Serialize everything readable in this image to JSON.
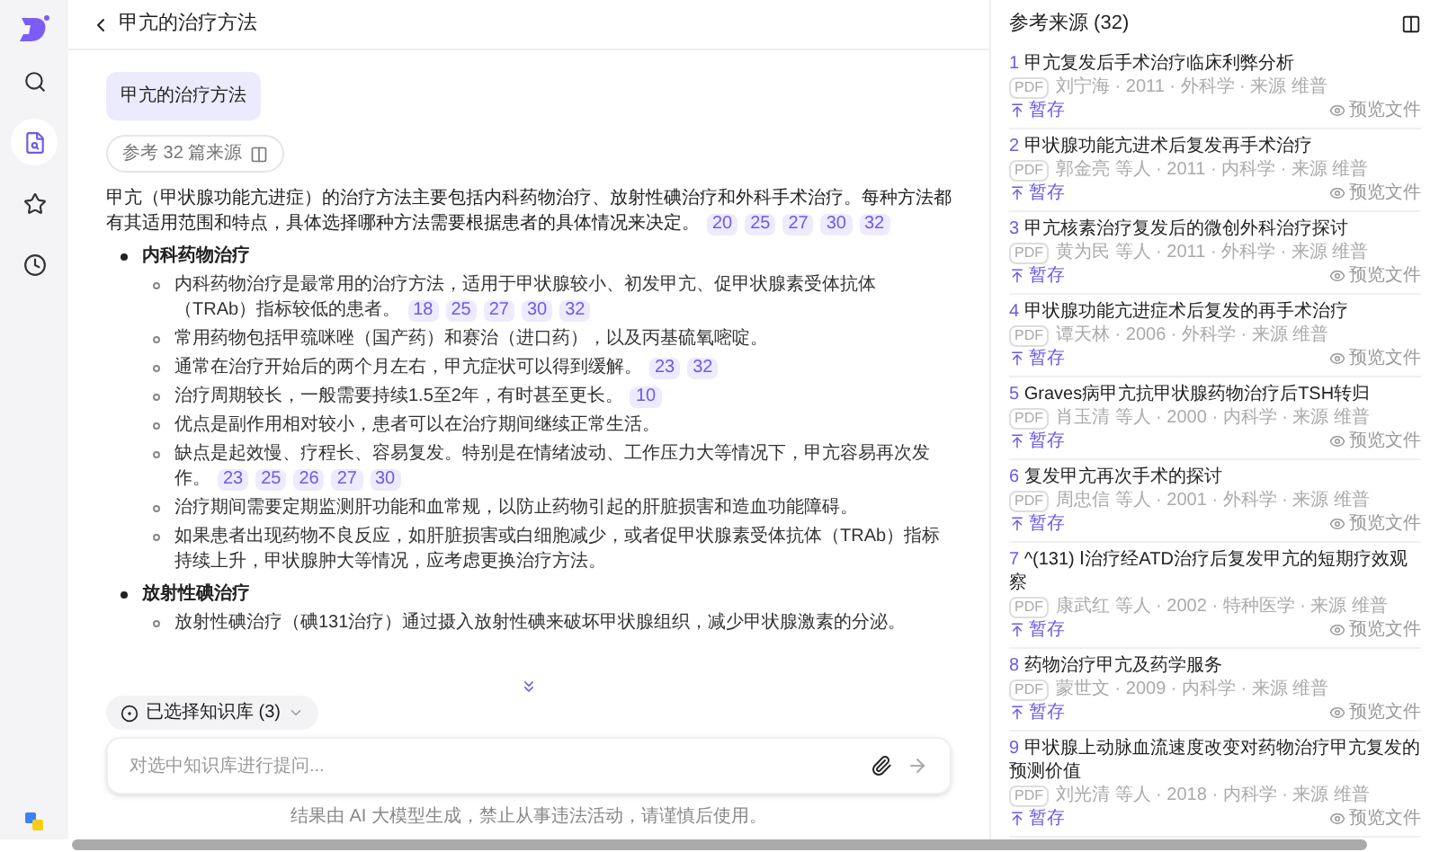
{
  "header": {
    "title": "甲亢的治疗方法"
  },
  "sidebar": {
    "items": [
      {
        "kind": "search",
        "selected": false
      },
      {
        "kind": "document",
        "selected": true
      },
      {
        "kind": "star",
        "selected": false
      },
      {
        "kind": "history",
        "selected": false
      }
    ]
  },
  "question": "甲亢的治疗方法",
  "sources_chip": "参考 32 篇来源",
  "answer": {
    "intro": {
      "text": "甲亢（甲状腺功能亢进症）的治疗方法主要包括内科药物治疗、放射性碘治疗和外科手术治疗。每种方法都有其适用范围和特点，具体选择哪种方法需要根据患者的具体情况来决定。",
      "refs": [
        "20",
        "25",
        "27",
        "30",
        "32"
      ]
    },
    "sections": [
      {
        "heading": "内科药物治疗",
        "items": [
          {
            "text": "内科药物治疗是最常用的治疗方法，适用于甲状腺较小、初发甲亢、促甲状腺素受体抗体（TRAb）指标较低的患者。",
            "refs": [
              "18",
              "25",
              "27",
              "30",
              "32"
            ]
          },
          {
            "text": "常用药物包括甲巯咪唑（国产药）和赛治（进口药），以及丙基硫氧嘧啶。"
          },
          {
            "text": "通常在治疗开始后的两个月左右，甲亢症状可以得到缓解。",
            "refs": [
              "23",
              "32"
            ]
          },
          {
            "text": "治疗周期较长，一般需要持续1.5至2年，有时甚至更长。",
            "refs": [
              "10"
            ]
          },
          {
            "text": "优点是副作用相对较小，患者可以在治疗期间继续正常生活。"
          },
          {
            "text": "缺点是起效慢、疗程长、容易复发。特别是在情绪波动、工作压力大等情况下，甲亢容易再次发作。",
            "refs": [
              "23",
              "25",
              "26",
              "27",
              "30"
            ]
          },
          {
            "text": "治疗期间需要定期监测肝功能和血常规，以防止药物引起的肝脏损害和造血功能障碍。"
          },
          {
            "text": "如果患者出现药物不良反应，如肝脏损害或白细胞减少，或者促甲状腺素受体抗体（TRAb）指标持续上升，甲状腺肿大等情况，应考虑更换治疗方法。"
          }
        ]
      },
      {
        "heading": "放射性碘治疗",
        "items": [
          {
            "text": "放射性碘治疗（碘131治疗）通过摄入放射性碘来破坏甲状腺组织，减少甲状腺激素的分泌。"
          }
        ]
      }
    ]
  },
  "knowledge_chip": "已选择知识库 (3)",
  "input": {
    "placeholder": "对选中知识库进行提问..."
  },
  "disclaimer": "结果由 AI 大模型生成，禁止从事违法活动，请谨慎后使用。",
  "sources_panel": {
    "title": "参考来源 (32)",
    "items": [
      {
        "number": "1",
        "title": "甲亢复发后手术治疗临床利弊分析",
        "badge": "PDF",
        "meta": "刘宁海 · 2011 · 外科学 · 来源 维普",
        "save": "暂存",
        "preview": "预览文件"
      },
      {
        "number": "2",
        "title": "甲状腺功能亢进术后复发再手术治疗",
        "badge": "PDF",
        "meta": "郭金亮 等人 · 2011 · 内科学 · 来源 维普",
        "save": "暂存",
        "preview": "预览文件"
      },
      {
        "number": "3",
        "title": "甲亢核素治疗复发后的微创外科治疗探讨",
        "badge": "PDF",
        "meta": "黄为民 等人 · 2011 · 外科学 · 来源 维普",
        "save": "暂存",
        "preview": "预览文件"
      },
      {
        "number": "4",
        "title": "甲状腺功能亢进症术后复发的再手术治疗",
        "badge": "PDF",
        "meta": "谭天林 · 2006 · 外科学 · 来源 维普",
        "save": "暂存",
        "preview": "预览文件"
      },
      {
        "number": "5",
        "title": "Graves病甲亢抗甲状腺药物治疗后TSH转归",
        "badge": "PDF",
        "meta": "肖玉清 等人 · 2000 · 内科学 · 来源 维普",
        "save": "暂存",
        "preview": "预览文件"
      },
      {
        "number": "6",
        "title": "复发甲亢再次手术的探讨",
        "badge": "PDF",
        "meta": "周忠信 等人 · 2001 · 外科学 · 来源 维普",
        "save": "暂存",
        "preview": "预览文件"
      },
      {
        "number": "7",
        "title": "^(131) Ⅰ治疗经ATD治疗后复发甲亢的短期疗效观察",
        "badge": "PDF",
        "meta": "康武红 等人 · 2002 · 特种医学 · 来源 维普",
        "save": "暂存",
        "preview": "预览文件"
      },
      {
        "number": "8",
        "title": "药物治疗甲亢及药学服务",
        "badge": "PDF",
        "meta": "蒙世文 · 2009 · 内科学 · 来源 维普",
        "save": "暂存",
        "preview": "预览文件"
      },
      {
        "number": "9",
        "title": "甲状腺上动脉血流速度改变对药物治疗甲亢复发的预测价值",
        "badge": "PDF",
        "meta": "刘光清 等人 · 2018 · 内科学 · 来源 维普",
        "save": "暂存",
        "preview": "预览文件"
      }
    ]
  }
}
